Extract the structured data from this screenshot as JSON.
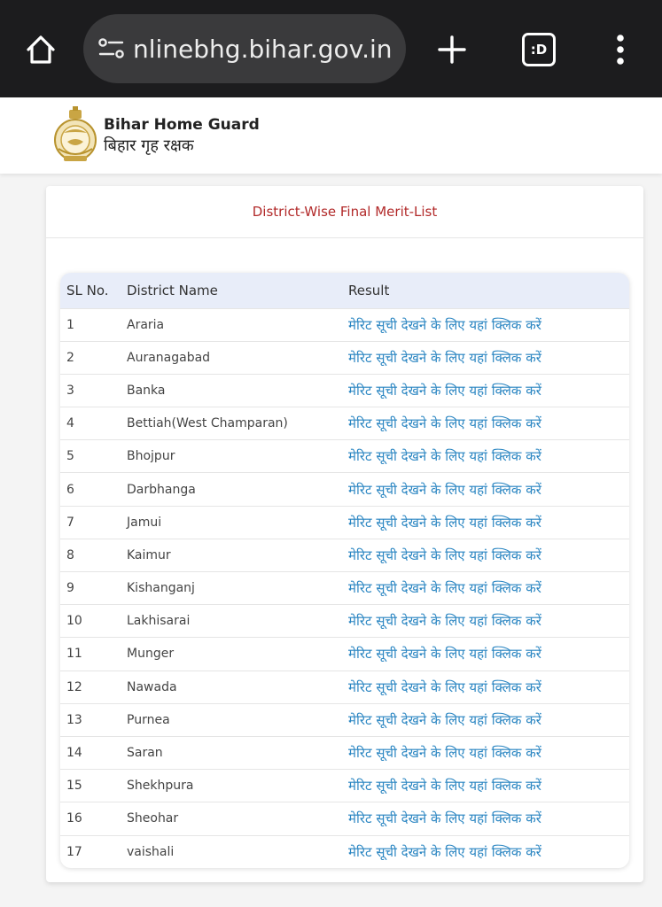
{
  "browser": {
    "url": "nlinebhg.bihar.gov.in",
    "tabs_label": ":D",
    "icons": [
      "home-icon",
      "site-info-icon",
      "plus-icon",
      "tabs-icon",
      "more-vertical-icon"
    ]
  },
  "header": {
    "brand_en": "Bihar Home Guard",
    "brand_hi": "बिहार गृह रक्षक",
    "logo_icon": "bihar-emblem-icon"
  },
  "card": {
    "title": "District-Wise Final Merit-List"
  },
  "table": {
    "columns": [
      "SL No.",
      "District Name",
      "Result"
    ],
    "rows": [
      {
        "sl": "1",
        "district": "Araria",
        "result": "मेरिट सूची देखने के लिए यहां क्लिक करें"
      },
      {
        "sl": "2",
        "district": "Auranagabad",
        "result": "मेरिट सूची देखने के लिए यहां क्लिक करें"
      },
      {
        "sl": "3",
        "district": "Banka",
        "result": "मेरिट सूची देखने के लिए यहां क्लिक करें"
      },
      {
        "sl": "4",
        "district": "Bettiah(West Champaran)",
        "result": "मेरिट सूची देखने के लिए यहां क्लिक करें"
      },
      {
        "sl": "5",
        "district": "Bhojpur",
        "result": "मेरिट सूची देखने के लिए यहां क्लिक करें"
      },
      {
        "sl": "6",
        "district": "Darbhanga",
        "result": "मेरिट सूची देखने के लिए यहां क्लिक करें"
      },
      {
        "sl": "7",
        "district": "Jamui",
        "result": "मेरिट सूची देखने के लिए यहां क्लिक करें"
      },
      {
        "sl": "8",
        "district": "Kaimur",
        "result": "मेरिट सूची देखने के लिए यहां क्लिक करें"
      },
      {
        "sl": "9",
        "district": "Kishanganj",
        "result": "मेरिट सूची देखने के लिए यहां क्लिक करें"
      },
      {
        "sl": "10",
        "district": "Lakhisarai",
        "result": "मेरिट सूची देखने के लिए यहां क्लिक करें"
      },
      {
        "sl": "11",
        "district": "Munger",
        "result": "मेरिट सूची देखने के लिए यहां क्लिक करें"
      },
      {
        "sl": "12",
        "district": "Nawada",
        "result": "मेरिट सूची देखने के लिए यहां क्लिक करें"
      },
      {
        "sl": "13",
        "district": "Purnea",
        "result": "मेरिट सूची देखने के लिए यहां क्लिक करें"
      },
      {
        "sl": "14",
        "district": "Saran",
        "result": "मेरिट सूची देखने के लिए यहां क्लिक करें"
      },
      {
        "sl": "15",
        "district": "Shekhpura",
        "result": "मेरिट सूची देखने के लिए यहां क्लिक करें"
      },
      {
        "sl": "16",
        "district": "Sheohar",
        "result": "मेरिट सूची देखने के लिए यहां क्लिक करें"
      },
      {
        "sl": "17",
        "district": "vaishali",
        "result": "मेरिट सूची देखने के लिए यहां क्लिक करें"
      }
    ]
  },
  "colors": {
    "title_red": "#b22a2a",
    "link_blue": "#2b86c2",
    "table_header_bg": "#e8edf9",
    "browser_bar": "#1c1c1e"
  }
}
